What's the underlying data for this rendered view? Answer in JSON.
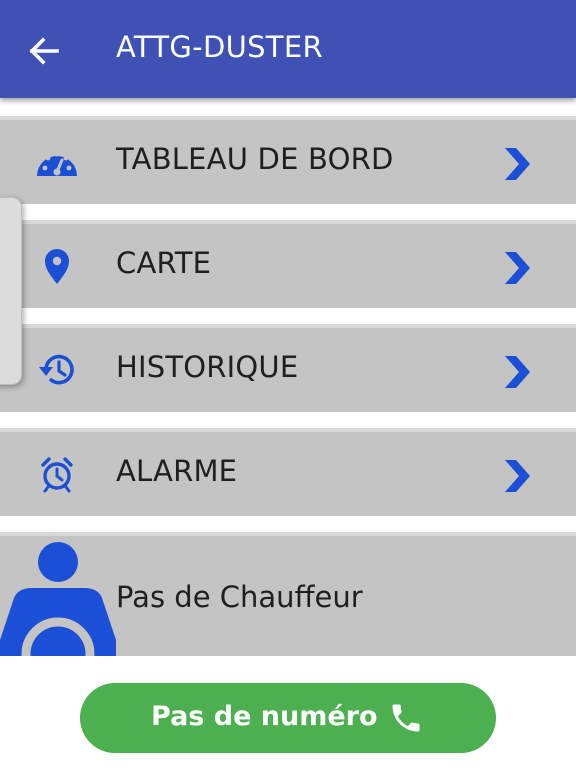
{
  "appbar": {
    "title": "ATTG-DUSTER",
    "back_icon": "arrow-left-icon",
    "background": "#3f51b5"
  },
  "menu": {
    "items": [
      {
        "label": "TABLEAU DE BORD",
        "icon": "speedometer-icon"
      },
      {
        "label": "CARTE",
        "icon": "map-pin-icon"
      },
      {
        "label": "HISTORIQUE",
        "icon": "history-icon"
      },
      {
        "label": "ALARME",
        "icon": "alarm-clock-icon"
      }
    ],
    "chevron_icon": "chevron-right-icon",
    "accent_color": "#1a4fd6",
    "row_background": "#c4c4c4"
  },
  "driver": {
    "label": "Pas de Chauffeur",
    "icon": "driver-avatar-icon"
  },
  "call": {
    "label": "Pas de numéro",
    "icon": "phone-icon",
    "background": "#4caf50"
  }
}
